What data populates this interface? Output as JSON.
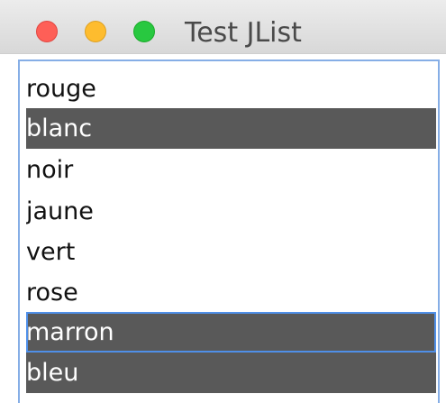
{
  "window": {
    "title": "Test JList"
  },
  "controls": {
    "close": {
      "icon": "close-icon",
      "color": "#fe5f57"
    },
    "minimize": {
      "icon": "minimize-icon",
      "color": "#febc2e"
    },
    "maximize": {
      "icon": "maximize-icon",
      "color": "#28c840"
    }
  },
  "list": {
    "items": [
      {
        "label": "rouge",
        "selected": false,
        "focused": false
      },
      {
        "label": "blanc",
        "selected": true,
        "focused": false
      },
      {
        "label": "noir",
        "selected": false,
        "focused": false
      },
      {
        "label": "jaune",
        "selected": false,
        "focused": false
      },
      {
        "label": "vert",
        "selected": false,
        "focused": false
      },
      {
        "label": "rose",
        "selected": false,
        "focused": false
      },
      {
        "label": "marron",
        "selected": true,
        "focused": true
      },
      {
        "label": "bleu",
        "selected": true,
        "focused": false
      }
    ]
  },
  "colors": {
    "selection_background": "#595959",
    "selection_text": "#ffffff",
    "focus_border": "#4f8fe8",
    "list_border": "#86aee6",
    "title_text": "#4a4a4a"
  }
}
